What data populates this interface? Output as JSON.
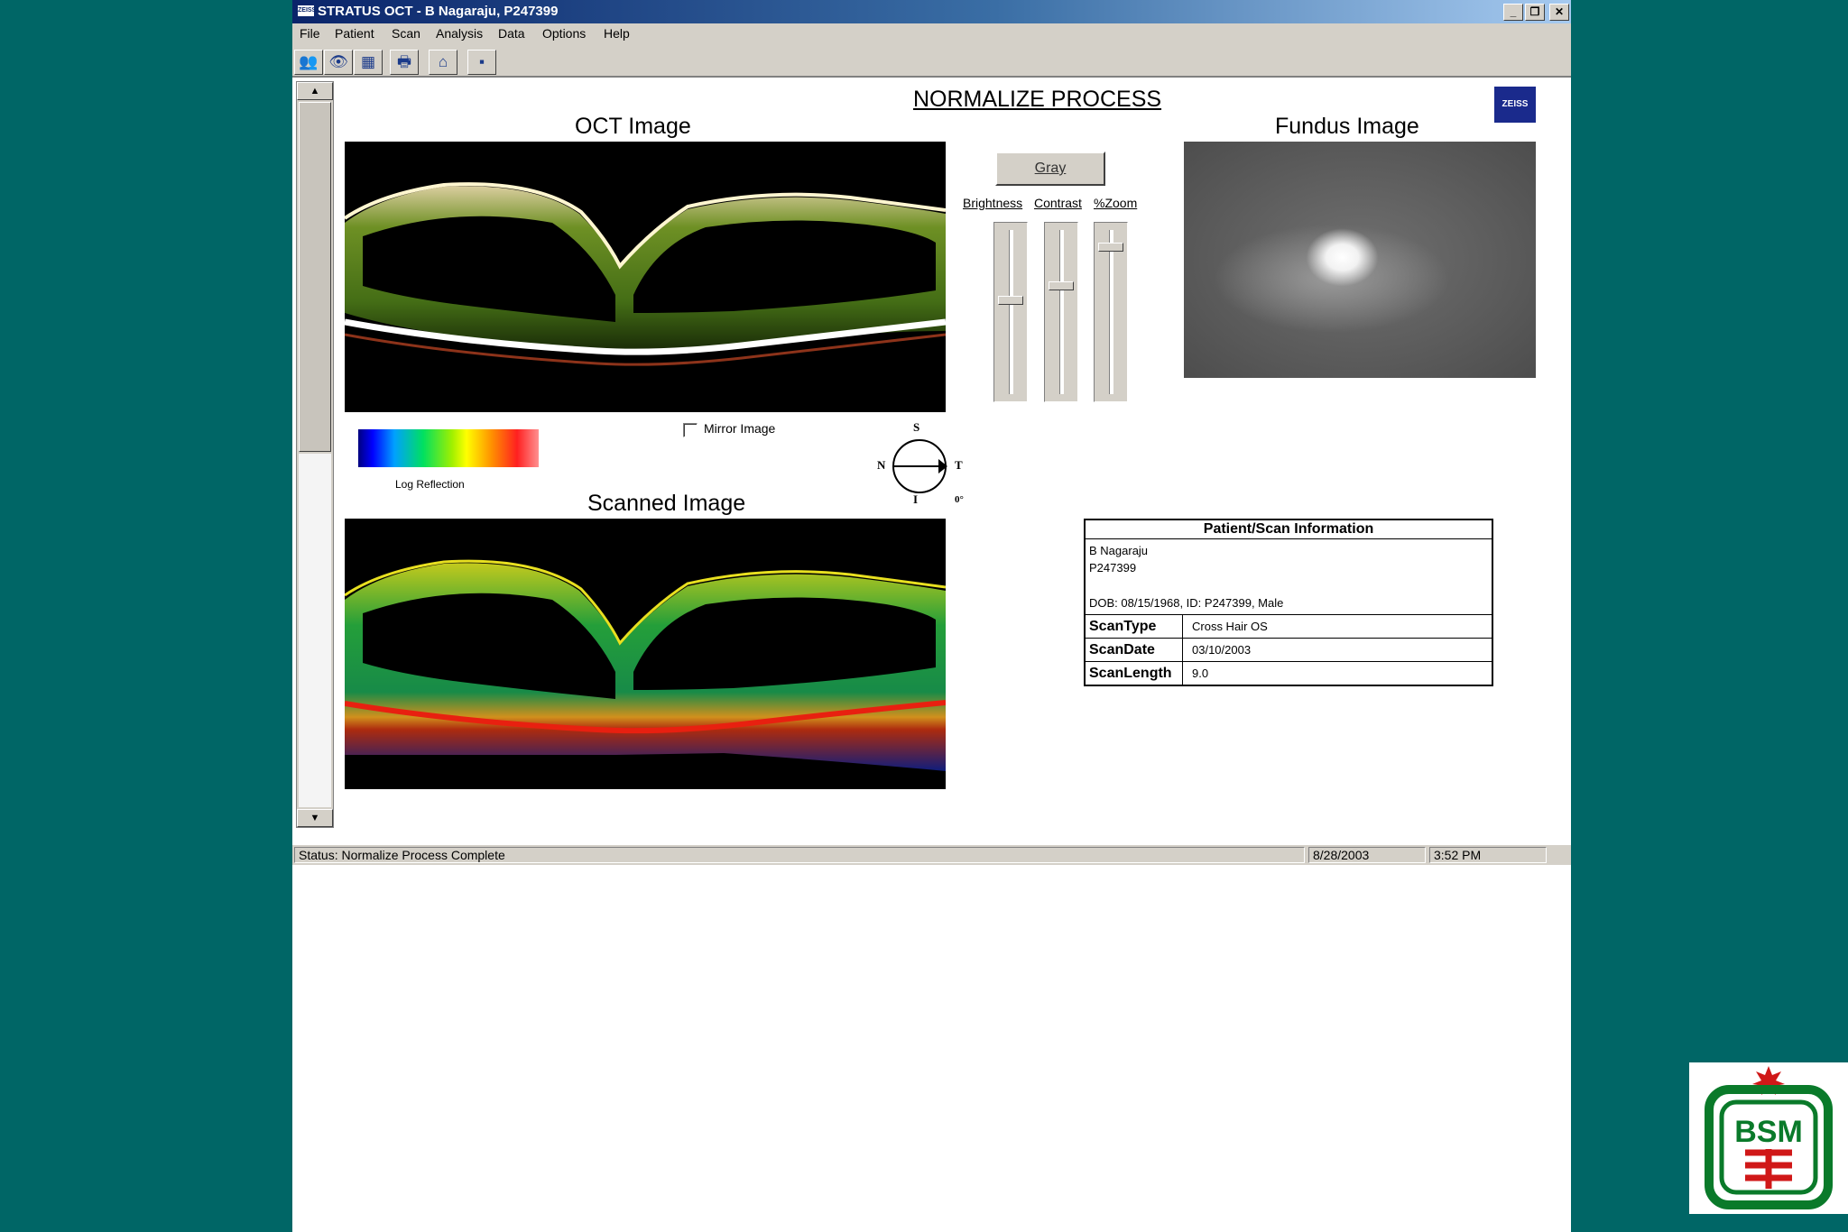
{
  "window": {
    "title": "STRATUS OCT - B Nagaraju, P247399",
    "title_icon_text": "ZEISS",
    "controls": [
      "_",
      "❐",
      "✕"
    ]
  },
  "menu": [
    "File",
    "Patient",
    "Scan",
    "Analysis",
    "Data",
    "Options",
    "Help"
  ],
  "toolbar": {
    "buttons": [
      {
        "icon": "patients-icon",
        "glyph": "👥"
      },
      {
        "icon": "eye-icon",
        "glyph": "👁"
      },
      {
        "icon": "analysis-icon",
        "glyph": "▦"
      },
      {
        "icon": "printer-icon",
        "glyph": "🖶"
      },
      {
        "icon": "home-icon",
        "glyph": "⌂"
      },
      {
        "icon": "blank-icon",
        "glyph": "▪"
      }
    ]
  },
  "scrollbar": {
    "up_arrow": "▲",
    "down_arrow": "▼"
  },
  "page": {
    "heading": "NORMALIZE PROCESS",
    "brand_logo_text": "ZEISS"
  },
  "oct_image": {
    "title": "OCT Image"
  },
  "scanned_image": {
    "title": "Scanned Image"
  },
  "fundus_image": {
    "title": "Fundus Image"
  },
  "controls": {
    "gray_button": "Gray",
    "sliders": [
      {
        "label": "Brightness",
        "value": 0.42
      },
      {
        "label": "Contrast",
        "value": 0.33
      },
      {
        "label": "%Zoom",
        "value": 0.08
      }
    ]
  },
  "colorbar": {
    "label": "Log Reflection"
  },
  "mirror_image": {
    "label": "Mirror Image",
    "checked": false
  },
  "orientation": {
    "top": "S",
    "bottom": "I",
    "left": "N",
    "right": "T",
    "angle": "0°"
  },
  "patient_info": {
    "header": "Patient/Scan Information",
    "name": "B Nagaraju",
    "id": "P247399",
    "details": "DOB: 08/15/1968, ID: P247399, Male",
    "rows": [
      {
        "key": "ScanType",
        "value": "Cross Hair  OS"
      },
      {
        "key": "ScanDate",
        "value": "03/10/2003"
      },
      {
        "key": "ScanLength",
        "value": "9.0"
      }
    ]
  },
  "status": {
    "text": "Status: Normalize Process Complete",
    "date": "8/28/2003",
    "time": "3:52 PM"
  },
  "colors": {
    "background": "#006666",
    "titlebar": "#0a246a",
    "chrome": "#d4d0c8",
    "zeiss_blue": "#1a2a8c",
    "logo_green": "#0a7a2a",
    "logo_red": "#d01818"
  },
  "corner_logo": {
    "text": "BSM"
  }
}
